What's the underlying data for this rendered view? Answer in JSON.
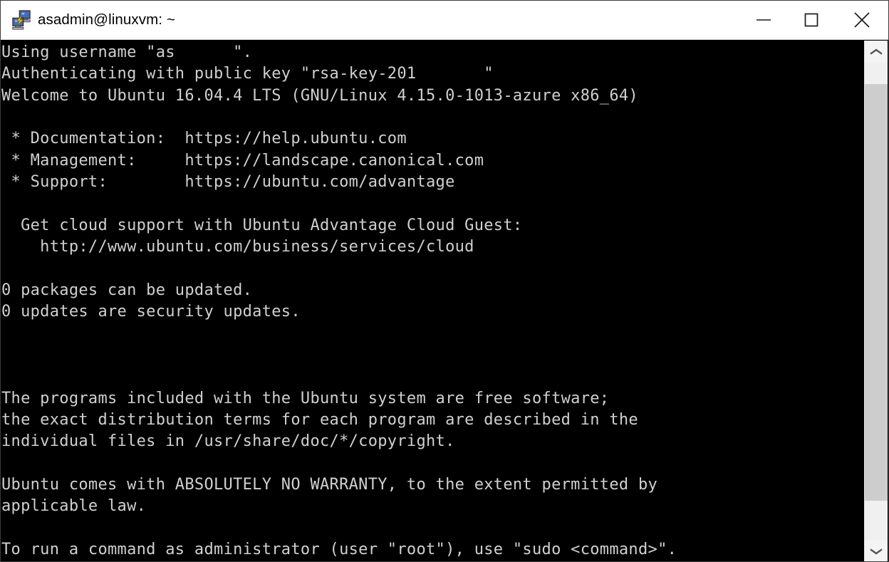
{
  "window": {
    "title": "asadmin@linuxvm: ~",
    "icon": "putty-icon",
    "controls": {
      "minimize": "minimize-button",
      "maximize": "maximize-button",
      "close": "close-button"
    }
  },
  "terminal": {
    "background_color": "#000000",
    "text_color": "#cfd0d0",
    "lines": [
      "Using username \"as",
      "Authenticating with public key \"rsa-key-201",
      "Welcome to Ubuntu 16.04.4 LTS (GNU/Linux 4.15.0-1013-azure x86_64)",
      "",
      " * Documentation:  https://help.ubuntu.com",
      " * Management:     https://landscape.canonical.com",
      " * Support:        https://ubuntu.com/advantage",
      "",
      "  Get cloud support with Ubuntu Advantage Cloud Guest:",
      "    http://www.ubuntu.com/business/services/cloud",
      "",
      "0 packages can be updated.",
      "0 updates are security updates.",
      "",
      "",
      "",
      "The programs included with the Ubuntu system are free software;",
      "the exact distribution terms for each program are described in the",
      "individual files in /usr/share/doc/*/copyright.",
      "",
      "Ubuntu comes with ABSOLUTELY NO WARRANTY, to the extent permitted by",
      "applicable law.",
      "",
      "To run a command as administrator (user \"root\"), use \"sudo <command>\"."
    ],
    "line_0_redacted_suffix": "\".",
    "line_1_redacted_suffix": "\""
  },
  "scrollbar": {
    "up_arrow": "scroll-up-arrow",
    "down_arrow": "scroll-down-arrow",
    "thumb": "scroll-thumb"
  }
}
